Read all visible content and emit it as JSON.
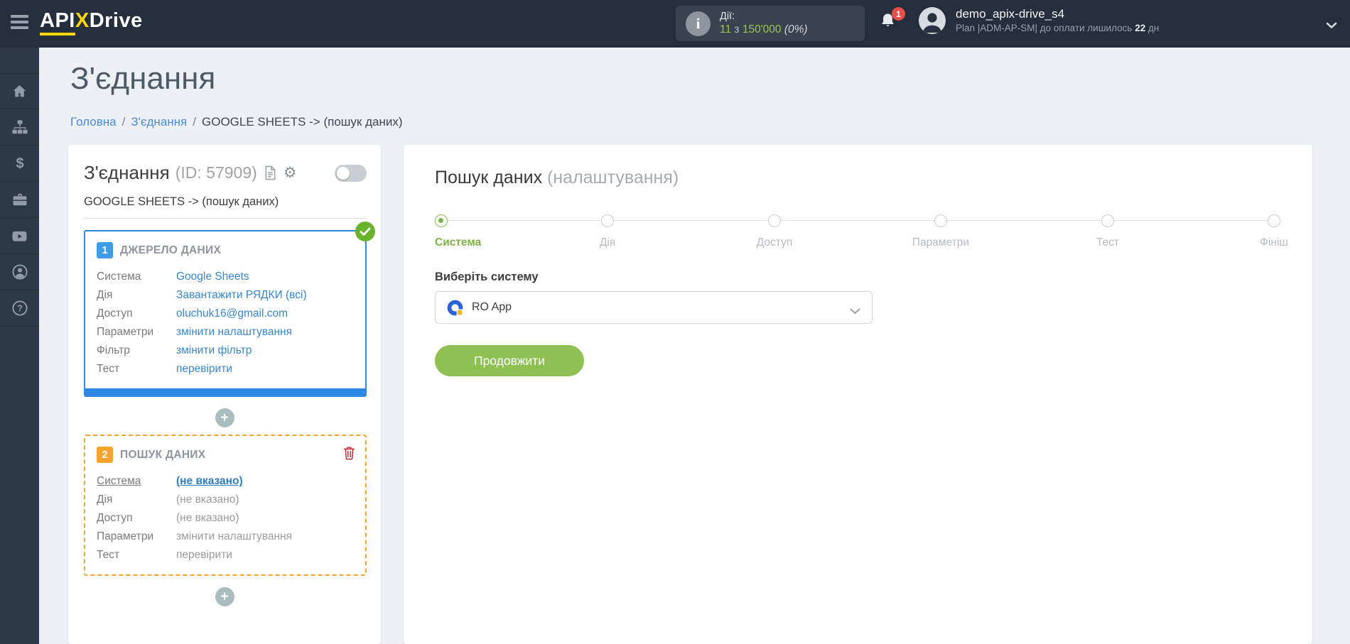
{
  "header": {
    "logo": {
      "part1": "API",
      "x": "X",
      "part2": "Drive"
    },
    "actions": {
      "label": "Дії:",
      "used": "11",
      "of_word": "з",
      "total": "150'000",
      "percent": "(0%)"
    },
    "notifications_count": "1",
    "user": {
      "name": "demo_apix-drive_s4",
      "plan_prefix": "Plan |ADM-AP-SM| до оплати лишилось",
      "days": "22",
      "days_suffix": "дн"
    }
  },
  "sidebar": {
    "items": [
      {
        "icon": "home-icon"
      },
      {
        "icon": "connections-sitemap-icon"
      },
      {
        "icon": "billing-dollar-icon"
      },
      {
        "icon": "services-briefcase-icon"
      },
      {
        "icon": "video-youtube-icon"
      },
      {
        "icon": "account-person-icon"
      },
      {
        "icon": "help-question-icon"
      }
    ]
  },
  "page": {
    "title": "З'єднання",
    "breadcrumb": {
      "home": "Головна",
      "connections": "З'єднання",
      "current": "GOOGLE SHEETS -> (пошук даних)"
    }
  },
  "connection_card": {
    "title": "З'єднання",
    "id_text": "(ID: 57909)",
    "subtitle": "GOOGLE SHEETS -> (пошук даних)",
    "add_button_label": "+",
    "source_box": {
      "number": "1",
      "title": "ДЖЕРЕЛО ДАНИХ",
      "rows": [
        {
          "label": "Система",
          "value": "Google Sheets"
        },
        {
          "label": "Дія",
          "value": "Завантажити РЯДКИ (всі)"
        },
        {
          "label": "Доступ",
          "value": "oluchuk16@gmail.com"
        },
        {
          "label": "Параметри",
          "value": "змінити налаштування"
        },
        {
          "label": "Фільтр",
          "value": "змінити фільтр"
        },
        {
          "label": "Тест",
          "value": "перевірити"
        }
      ]
    },
    "search_box": {
      "number": "2",
      "title": "ПОШУК ДАНИХ",
      "rows": [
        {
          "label": "Система",
          "value": "(не вказано)"
        },
        {
          "label": "Дія",
          "value": "(не вказано)"
        },
        {
          "label": "Доступ",
          "value": "(не вказано)"
        },
        {
          "label": "Параметри",
          "value": "змінити налаштування"
        },
        {
          "label": "Тест",
          "value": "перевірити"
        }
      ]
    }
  },
  "settings_panel": {
    "title": "Пошук даних",
    "title_suffix": "(налаштування)",
    "steps": [
      {
        "label": "Система",
        "state": "active"
      },
      {
        "label": "Дія",
        "state": "pending"
      },
      {
        "label": "Доступ",
        "state": "pending"
      },
      {
        "label": "Параметри",
        "state": "pending"
      },
      {
        "label": "Тест",
        "state": "pending"
      },
      {
        "label": "Фініш",
        "state": "pending"
      }
    ],
    "form": {
      "label": "Виберіть систему",
      "selected_system": "RO App",
      "continue_button": "Продовжити"
    }
  },
  "colors": {
    "header_bg": "#242e3c",
    "sidebar_bg": "#2e3947",
    "accent_blue": "#2e87e0",
    "accent_orange": "#f6a42b",
    "accent_green": "#8fc152",
    "link_blue": "#3a86ca",
    "danger_red": "#cb2027",
    "logo_yellow": "#ffd60a",
    "page_bg": "#edf1f6"
  }
}
